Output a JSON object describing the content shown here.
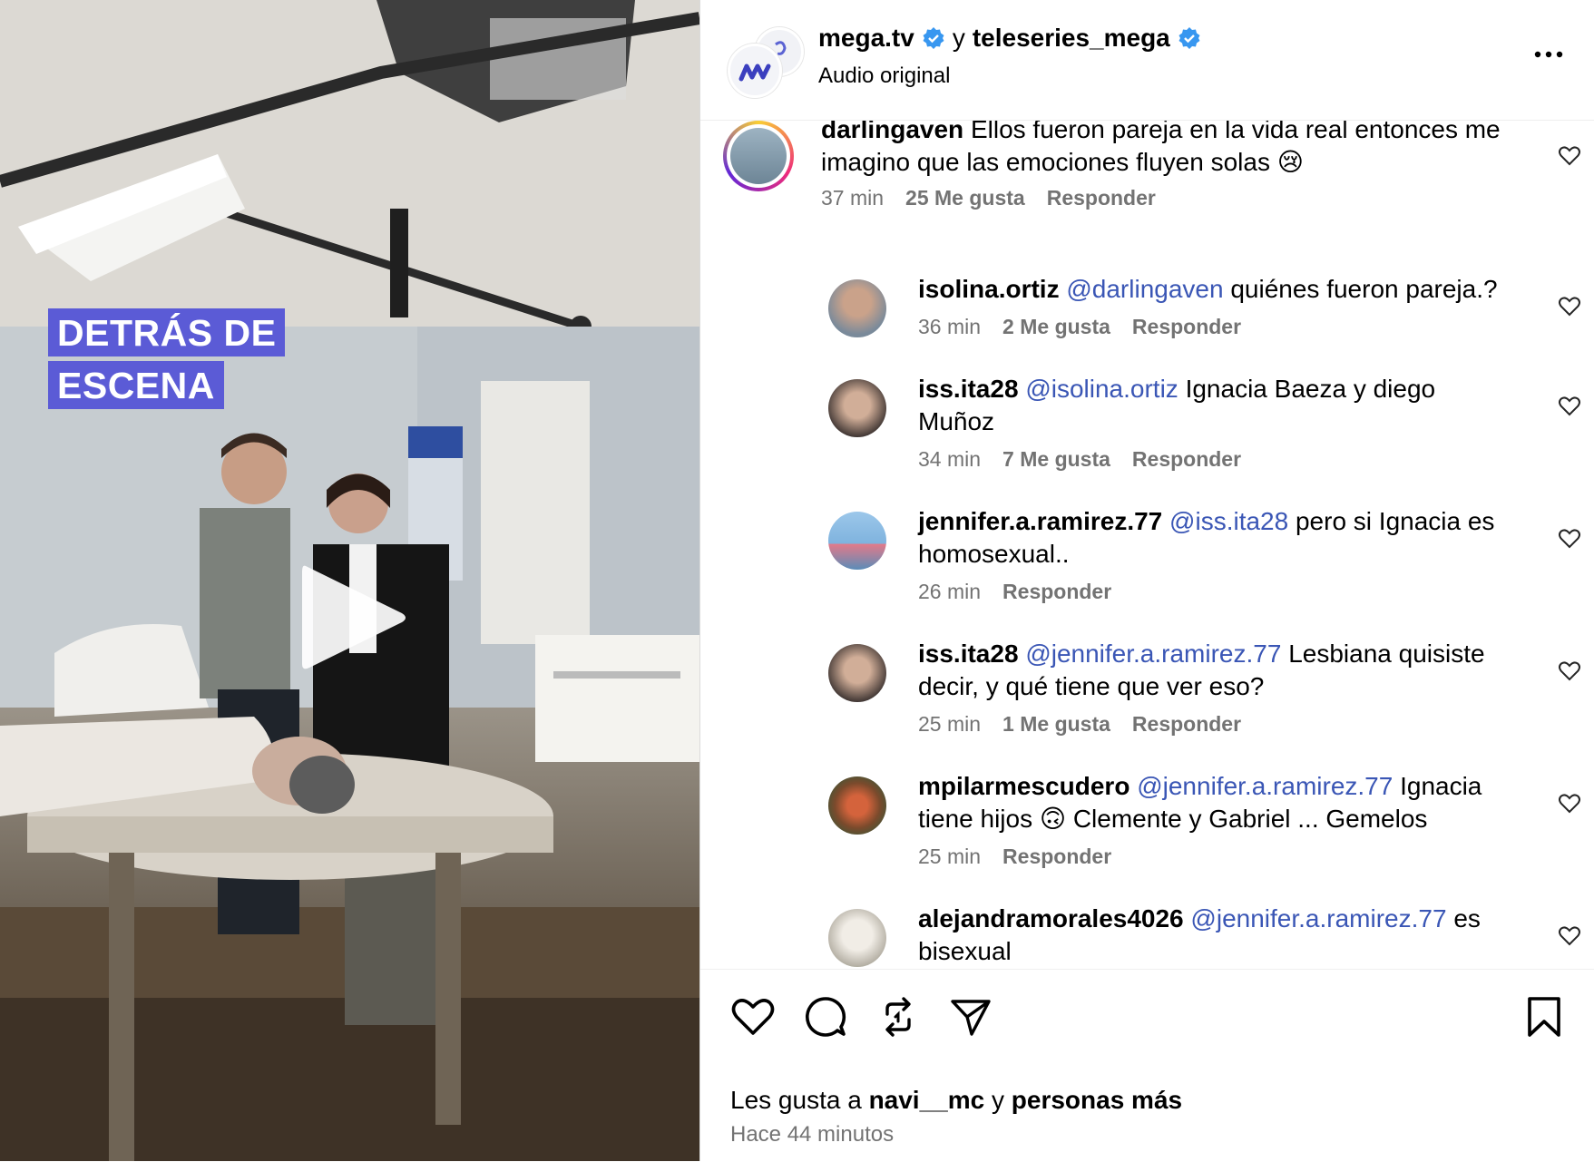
{
  "media": {
    "badge_line1": "DETRÁS DE",
    "badge_line2": "ESCENA",
    "badge_color": "#5b5bd6",
    "play_icon": "play-icon"
  },
  "header": {
    "account1": "mega.tv",
    "connector": "y",
    "account2": "teleseries_mega",
    "audio": "Audio original",
    "verified_color": "#3897f0"
  },
  "comments": [
    {
      "user": "darlingaven",
      "mention": "",
      "text": "Ellos fueron pareja en la vida real entonces me",
      "text2": "imagino que las emociones fluyen solas 😢",
      "time": "37 min",
      "likes": "25 Me gusta",
      "reply": "Responder"
    },
    {
      "user": "isolina.ortiz",
      "mention": "@darlingaven",
      "text": "quiénes fueron pareja.?",
      "text2": "",
      "time": "36 min",
      "likes": "2 Me gusta",
      "reply": "Responder"
    },
    {
      "user": "iss.ita28",
      "mention": "@isolina.ortiz",
      "text": "Ignacia Baeza y diego",
      "text2": "Muñoz",
      "time": "34 min",
      "likes": "7 Me gusta",
      "reply": "Responder"
    },
    {
      "user": "jennifer.a.ramirez.77",
      "mention": "@iss.ita28",
      "text": "pero si Ignacia es",
      "text2": "homosexual..",
      "time": "26 min",
      "likes": "",
      "reply": "Responder"
    },
    {
      "user": "iss.ita28",
      "mention": "@jennifer.a.ramirez.77",
      "text": "Lesbiana quisiste",
      "text2": "decir, y qué tiene que ver eso?",
      "time": "25 min",
      "likes": "1 Me gusta",
      "reply": "Responder"
    },
    {
      "user": "mpilarmescudero",
      "mention": "@jennifer.a.ramirez.77",
      "text": "Ignacia",
      "text2": "tiene hijos 🙃 Clemente y Gabriel ... Gemelos",
      "time": "25 min",
      "likes": "",
      "reply": "Responder"
    },
    {
      "user": "alejandramorales4026",
      "mention": "@jennifer.a.ramirez.77",
      "text": "es",
      "text2": "bisexual",
      "time": "",
      "likes": "",
      "reply": ""
    }
  ],
  "footer": {
    "likes_prefix": "Les gusta a",
    "likes_user": "navi__mc",
    "likes_connector": "y",
    "likes_others": "personas más",
    "time_ago": "Hace 44 minutos"
  },
  "icons": {
    "like": "heart-icon",
    "comment": "comment-icon",
    "repost": "repost-icon",
    "share": "send-icon",
    "save": "bookmark-icon"
  }
}
